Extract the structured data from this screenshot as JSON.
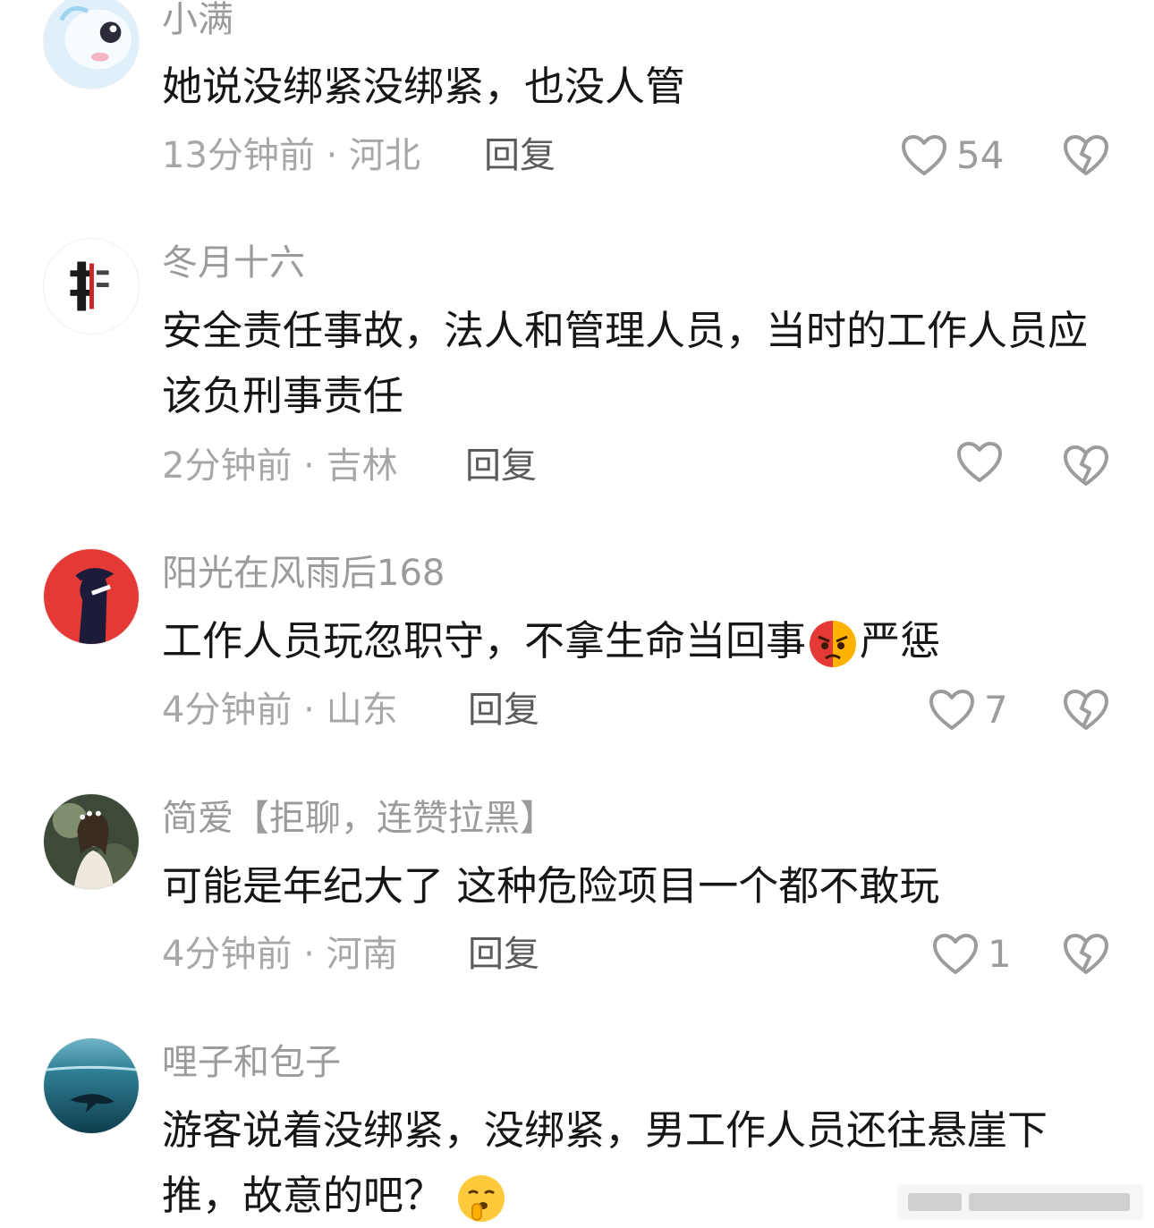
{
  "comments": [
    {
      "username": "小满",
      "text": "她说没绑紧没绑紧，也没人管",
      "time_location": "13分钟前 · 河北",
      "reply_label": "回复",
      "likes": "54"
    },
    {
      "username": "冬月十六",
      "text": "安全责任事故，法人和管理人员，当时的工作人员应该负刑事责任",
      "time_location": "2分钟前 · 吉林",
      "reply_label": "回复",
      "likes": ""
    },
    {
      "username": "阳光在风雨后168",
      "text_before_emoji": "工作人员玩忽职守，不拿生命当回事",
      "text_after_emoji": "严惩",
      "time_location": "4分钟前 · 山东",
      "reply_label": "回复",
      "likes": "7"
    },
    {
      "username": "简爱【拒聊，连赞拉黑】",
      "text": "可能是年纪大了 这种危险项目一个都不敢玩",
      "time_location": "4分钟前 · 河南",
      "reply_label": "回复",
      "likes": "1"
    },
    {
      "username": "哩子和包子",
      "text_before_emoji": "游客说着没绑紧，没绑紧，男工作人员还往悬崖下推，故意的吧？",
      "time_location": "",
      "reply_label": "",
      "likes": ""
    }
  ],
  "icons": {
    "like": "heart-outline-icon",
    "dislike": "broken-heart-icon"
  },
  "colors": {
    "username": "#9b9b9b",
    "text": "#161616",
    "meta": "#a7a7a7",
    "reply": "#5b5b5b",
    "icon": "#9c9c9c"
  }
}
